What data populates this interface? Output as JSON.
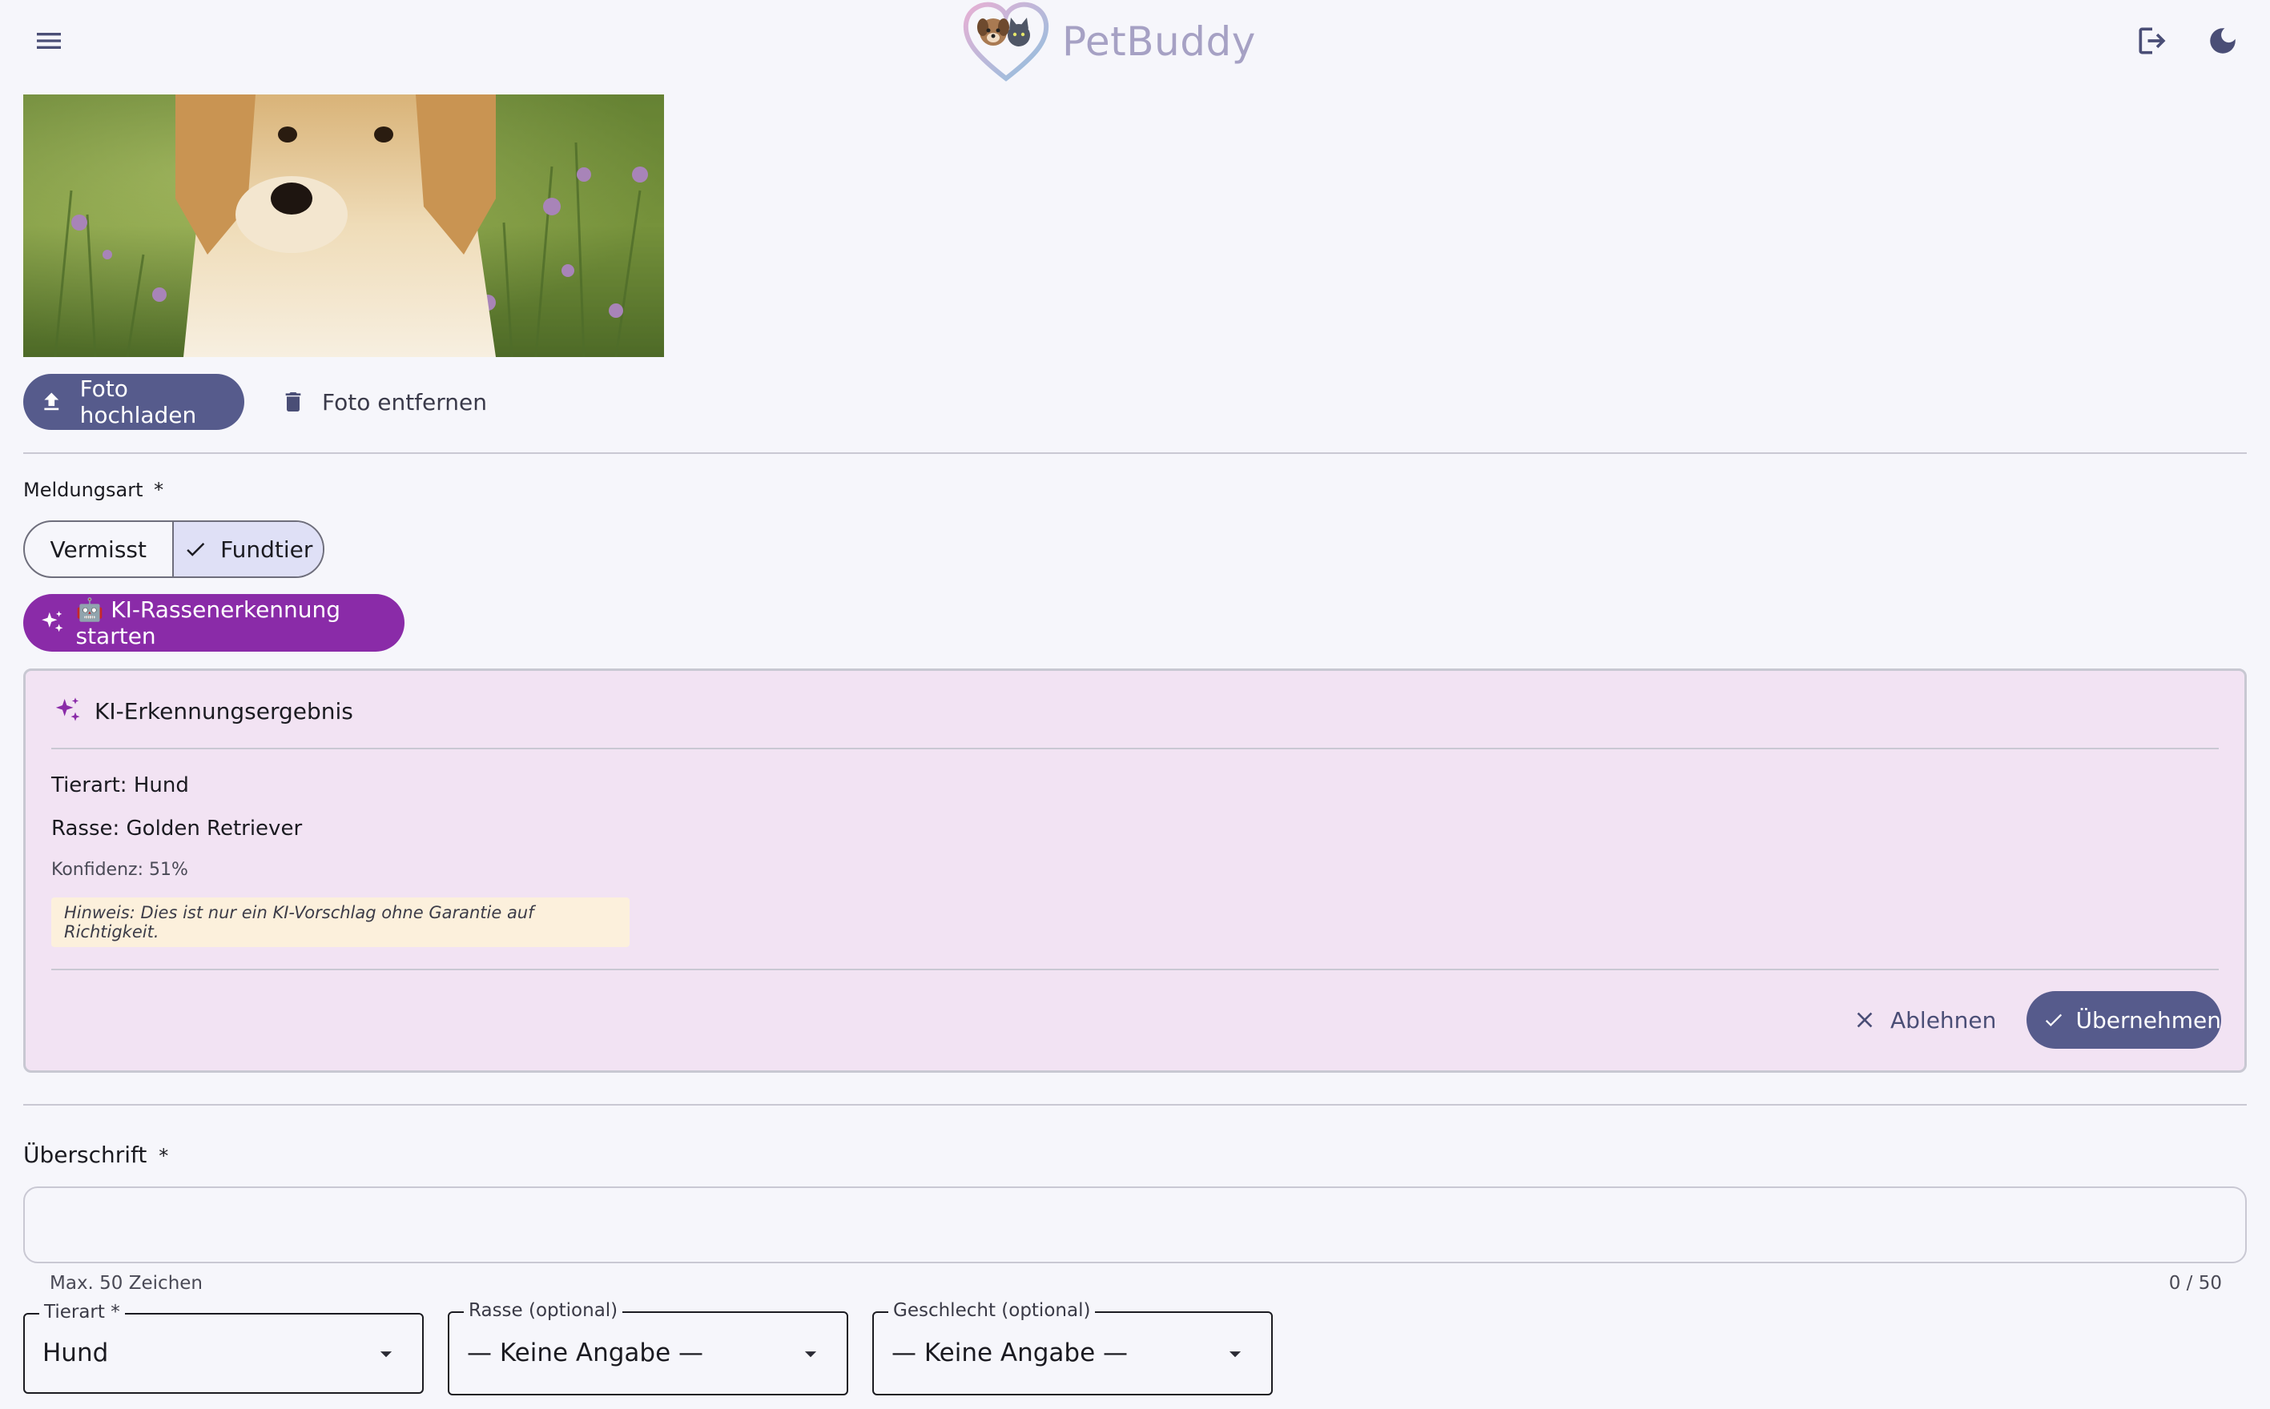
{
  "header": {
    "app_name": "PetBuddy"
  },
  "photo": {
    "upload_label": "Foto hochladen",
    "remove_label": "Foto entfernen"
  },
  "report_type": {
    "label": "Meldungsart",
    "required_mark": "*",
    "options": [
      "Vermisst",
      "Fundtier"
    ],
    "selected": "Fundtier"
  },
  "ki_button": {
    "label": "🤖 KI-Rassenerkennung starten"
  },
  "ki_result": {
    "title": "KI-Erkennungsergebnis",
    "species": "Tierart: Hund",
    "breed": "Rasse: Golden Retriever",
    "confidence": "Konfidenz: 51%",
    "hint": "Hinweis: Dies ist nur ein KI-Vorschlag ohne Garantie auf Richtigkeit.",
    "reject_label": "Ablehnen",
    "accept_label": "Übernehmen"
  },
  "headline_field": {
    "label": "Überschrift",
    "required_mark": "*",
    "value": "",
    "helper": "Max. 50 Zeichen",
    "counter": "0 / 50"
  },
  "selects": [
    {
      "label": "Tierart *",
      "value": "Hund"
    },
    {
      "label": "Rasse (optional)",
      "value": "— Keine Angabe —"
    },
    {
      "label": "Geschlecht (optional)",
      "value": "— Keine Angabe —"
    }
  ],
  "colors": {
    "primary": "#565b8c",
    "ki_accent": "#8a2ba8",
    "ki_card_bg": "#f2e3f3",
    "hint_bg": "#fcf0dc",
    "background": "#f6f6fb"
  },
  "icons": {
    "menu": "menu-icon",
    "logout": "logout-icon",
    "theme": "dark-mode-icon",
    "upload": "upload-icon",
    "trash": "trash-icon",
    "check": "check-icon",
    "sparkle": "sparkle-icon",
    "close": "close-icon",
    "dropdown": "arrow-drop-down-icon"
  }
}
